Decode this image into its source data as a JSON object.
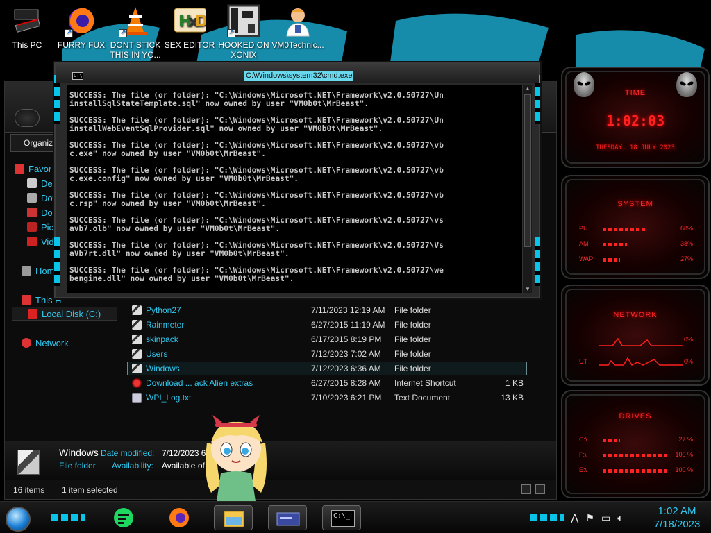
{
  "desktop_icons": [
    {
      "label": "This PC",
      "icon": "computer-icon"
    },
    {
      "label": "FURRY FUX",
      "icon": "firefox-icon"
    },
    {
      "label": "DONT STICK THIS IN YO...",
      "icon": "vlc-cone-icon"
    },
    {
      "label": "SEX EDITOR",
      "icon": "xd-editor-icon"
    },
    {
      "label": "HOOKED ON XONIX",
      "icon": "xonix-game-icon"
    },
    {
      "label": "VM0Technic...",
      "icon": "doctor-icon"
    }
  ],
  "cmd": {
    "title": "C:\\Windows\\system32\\cmd.exe",
    "icon_label": "C:\\_",
    "lines": [
      "SUCCESS: The file (or folder): \"C:\\Windows\\Microsoft.NET\\Framework\\v2.0.50727\\Un",
      "installSqlStateTemplate.sql\" now owned by user \"VM0b0t\\MrBeast\".",
      "",
      "SUCCESS: The file (or folder): \"C:\\Windows\\Microsoft.NET\\Framework\\v2.0.50727\\Un",
      "installWebEventSqlProvider.sql\" now owned by user \"VM0b0t\\MrBeast\".",
      "",
      "SUCCESS: The file (or folder): \"C:\\Windows\\Microsoft.NET\\Framework\\v2.0.50727\\vb",
      "c.exe\" now owned by user \"VM0b0t\\MrBeast\".",
      "",
      "SUCCESS: The file (or folder): \"C:\\Windows\\Microsoft.NET\\Framework\\v2.0.50727\\vb",
      "c.exe.config\" now owned by user \"VM0b0t\\MrBeast\".",
      "",
      "SUCCESS: The file (or folder): \"C:\\Windows\\Microsoft.NET\\Framework\\v2.0.50727\\vb",
      "c.rsp\" now owned by user \"VM0b0t\\MrBeast\".",
      "",
      "SUCCESS: The file (or folder): \"C:\\Windows\\Microsoft.NET\\Framework\\v2.0.50727\\vs",
      "avb7.olb\" now owned by user \"VM0b0t\\MrBeast\".",
      "",
      "SUCCESS: The file (or folder): \"C:\\Windows\\Microsoft.NET\\Framework\\v2.0.50727\\Vs",
      "aVb7rt.dll\" now owned by user \"VM0b0t\\MrBeast\".",
      "",
      "SUCCESS: The file (or folder): \"C:\\Windows\\Microsoft.NET\\Framework\\v2.0.50727\\we",
      "bengine.dll\" now owned by user \"VM0b0t\\MrBeast\"."
    ]
  },
  "explorer": {
    "organize_label": "Organize",
    "nav": [
      {
        "label": "Favor",
        "icon": "star-icon",
        "indent": 1
      },
      {
        "label": "Des",
        "icon": "desktop-icon",
        "indent": 2
      },
      {
        "label": "Dow",
        "icon": "downloads-icon",
        "indent": 2
      },
      {
        "label": "Doc",
        "icon": "documents-icon",
        "indent": 2
      },
      {
        "label": "Pict",
        "icon": "pictures-icon",
        "indent": 2
      },
      {
        "label": "Vide",
        "icon": "videos-icon",
        "indent": 2
      },
      {
        "label": "Hom",
        "icon": "homegroup-icon",
        "indent": 1
      },
      {
        "label": "This H",
        "icon": "this-pc-icon",
        "indent": 1
      },
      {
        "label": "Local Disk (C:)",
        "icon": "drive-icon",
        "indent": 2
      },
      {
        "label": "Network",
        "icon": "network-icon",
        "indent": 1
      }
    ],
    "files": [
      {
        "name": "Python27",
        "date": "7/11/2023 12:19 AM",
        "type": "File folder",
        "size": "",
        "kind": "folder"
      },
      {
        "name": "Rainmeter",
        "date": "6/27/2015 11:19 AM",
        "type": "File folder",
        "size": "",
        "kind": "folder"
      },
      {
        "name": "skinpack",
        "date": "6/17/2015 8:19 PM",
        "type": "File folder",
        "size": "",
        "kind": "folder"
      },
      {
        "name": "Users",
        "date": "7/12/2023 7:02 AM",
        "type": "File folder",
        "size": "",
        "kind": "folder"
      },
      {
        "name": "Windows",
        "date": "7/12/2023 6:36 AM",
        "type": "File folder",
        "size": "",
        "kind": "folder"
      },
      {
        "name": "Download ... ack Alien extras",
        "date": "6/27/2015 8:28 AM",
        "type": "Internet Shortcut",
        "size": "1 KB",
        "kind": "link"
      },
      {
        "name": "WPI_Log.txt",
        "date": "7/10/2023 6:21 PM",
        "type": "Text Document",
        "size": "13 KB",
        "kind": "txt"
      }
    ],
    "selected_file": "Windows",
    "details": {
      "name": "Windows",
      "type": "File folder",
      "date_modified_label": "Date modified:",
      "date_modified_value": "7/12/2023 6:",
      "availability_label": "Availability:",
      "availability_value": "Available of"
    },
    "status": {
      "items": "16 items",
      "selected": "1 item selected"
    }
  },
  "gadgets": {
    "time": {
      "label": "TIME",
      "clock": "1:02:03",
      "date": "TUESDAY, 18 JULY 2023"
    },
    "system": {
      "label": "SYSTEM",
      "rows": [
        {
          "label": "PU",
          "value": "68%",
          "level": 0.68
        },
        {
          "label": "AM",
          "value": "38%",
          "level": 0.38
        },
        {
          "label": "WAP",
          "value": "27%",
          "level": 0.27
        }
      ]
    },
    "network": {
      "label": "NETWORK",
      "rows": [
        {
          "label": "",
          "value": "0%"
        },
        {
          "label": "UT",
          "value": "0%"
        }
      ]
    },
    "drives": {
      "label": "DRIVES",
      "rows": [
        {
          "label": "C:\\",
          "value": "27 %",
          "level": 0.27
        },
        {
          "label": "F:\\",
          "value": "100 %",
          "level": 1.0
        },
        {
          "label": "E:\\",
          "value": "100 %",
          "level": 1.0
        }
      ]
    }
  },
  "taskbar": {
    "apps": [
      {
        "name": "notes-app-icon",
        "active": false
      },
      {
        "name": "firefox-icon",
        "active": false
      },
      {
        "name": "file-explorer-icon",
        "active": true
      },
      {
        "name": "control-panel-icon",
        "active": true
      },
      {
        "name": "cmd-icon",
        "active": true
      }
    ],
    "cmd_icon_text": "C:\\_",
    "clock_time": "1:02 AM",
    "clock_date": "7/18/2023",
    "accent": "#08c4e8"
  },
  "colors": {
    "accent_cyan": "#31c8ee",
    "gadget_red": "#ff2020"
  }
}
